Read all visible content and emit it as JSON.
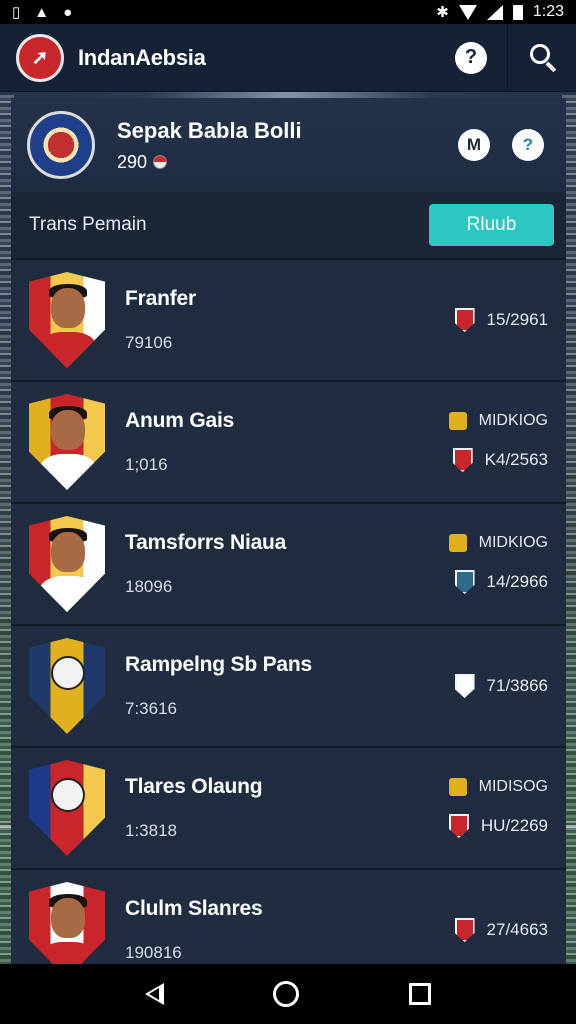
{
  "status_bar": {
    "time": "1:23"
  },
  "header": {
    "app_title": "IndanAebsia",
    "help_label": "?",
    "icons": [
      "app-logo-icon",
      "help-icon",
      "search-icon"
    ]
  },
  "team": {
    "name": "Sepak Babla Bolli",
    "number": "290",
    "action_left": "M",
    "action_right": "?"
  },
  "transfer": {
    "label": "Trans Pemain",
    "button_label": "Rluub"
  },
  "players": [
    {
      "name": "Franfer",
      "code": "79106",
      "position": "",
      "value": "15/2961",
      "shield": [
        "#c9262c",
        "#f2c94c",
        "#ffffff"
      ],
      "shirt": "#c9262c",
      "emblem": false,
      "badge_color": "#c9262c"
    },
    {
      "name": "Anum Gais",
      "code": "1;016",
      "position": "MIDKIOG",
      "value": "K4/2563",
      "shield": [
        "#e0b020",
        "#c9262c",
        "#f2c94c"
      ],
      "shirt": "#ffffff",
      "emblem": false,
      "badge_color": "#c9262c"
    },
    {
      "name": "Tamsforrs Niaua",
      "code": "18096",
      "position": "MIDKIOG",
      "value": "14/2966",
      "shield": [
        "#c9262c",
        "#f2c94c",
        "#ffffff"
      ],
      "shirt": "#ffffff",
      "emblem": false,
      "badge_color": "#2f6a8a"
    },
    {
      "name": "Rampelng Sb Pans",
      "code": "7:3616",
      "position": "",
      "value": "71/3866",
      "shield": [
        "#1e3a6a",
        "#e0b020",
        "#1e3a6a"
      ],
      "shirt": "#222222",
      "emblem": true,
      "badge_color": "#ffffff"
    },
    {
      "name": "Tlares Olaung",
      "code": "1:3818",
      "position": "MIDISOG",
      "value": "HU/2269",
      "shield": [
        "#1e3a8a",
        "#c9262c",
        "#f2c94c"
      ],
      "shirt": "#c9262c",
      "emblem": true,
      "badge_color": "#c9262c"
    },
    {
      "name": "Clulm Slanres",
      "code": "190816",
      "position": "",
      "value": "27/4663",
      "shield": [
        "#c9262c",
        "#ffffff",
        "#c9262c"
      ],
      "shirt": "#c9262c",
      "emblem": false,
      "badge_color": "#c9262c"
    }
  ],
  "nav": {
    "icons": [
      "back-icon",
      "home-icon",
      "recent-apps-icon"
    ]
  }
}
